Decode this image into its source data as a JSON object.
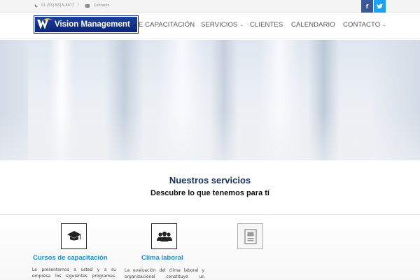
{
  "topbar": {
    "phone": "01 (55) 5615-8977",
    "separator": "/",
    "email_label": "Contacto",
    "social": [
      {
        "icon": "facebook-icon",
        "glyph": "f",
        "color": "#3b5998"
      },
      {
        "icon": "twitter-icon",
        "glyph": "t",
        "color": "#1da1f2"
      }
    ]
  },
  "header": {
    "logo_text": "Vision Management",
    "nav": [
      {
        "label": "E CAPACITACIÓN",
        "has_dropdown": false
      },
      {
        "label": "SERVICIOS",
        "has_dropdown": true
      },
      {
        "label": "CLIENTES",
        "has_dropdown": false
      },
      {
        "label": "CALENDARIO",
        "has_dropdown": false
      },
      {
        "label": "CONTACTO",
        "has_dropdown": true
      }
    ]
  },
  "services": {
    "title": "Nuestros servicios",
    "subtitle": "Descubre lo que tenemos para tí",
    "items": [
      {
        "icon": "graduation-cap-icon",
        "title": "Cursos de capacitación",
        "description": "Le presentamos a usted y a su empresa los siguientes programas."
      },
      {
        "icon": "group-icon",
        "title": "Clima laboral",
        "description": "La evaluación del clima laboral y organizacional constituye un"
      },
      {
        "icon": "document-icon",
        "title": "",
        "description": ""
      }
    ]
  },
  "colors": {
    "brand_blue": "#0b2577",
    "link_blue": "#1c8fd3",
    "title_navy": "#14305d"
  }
}
